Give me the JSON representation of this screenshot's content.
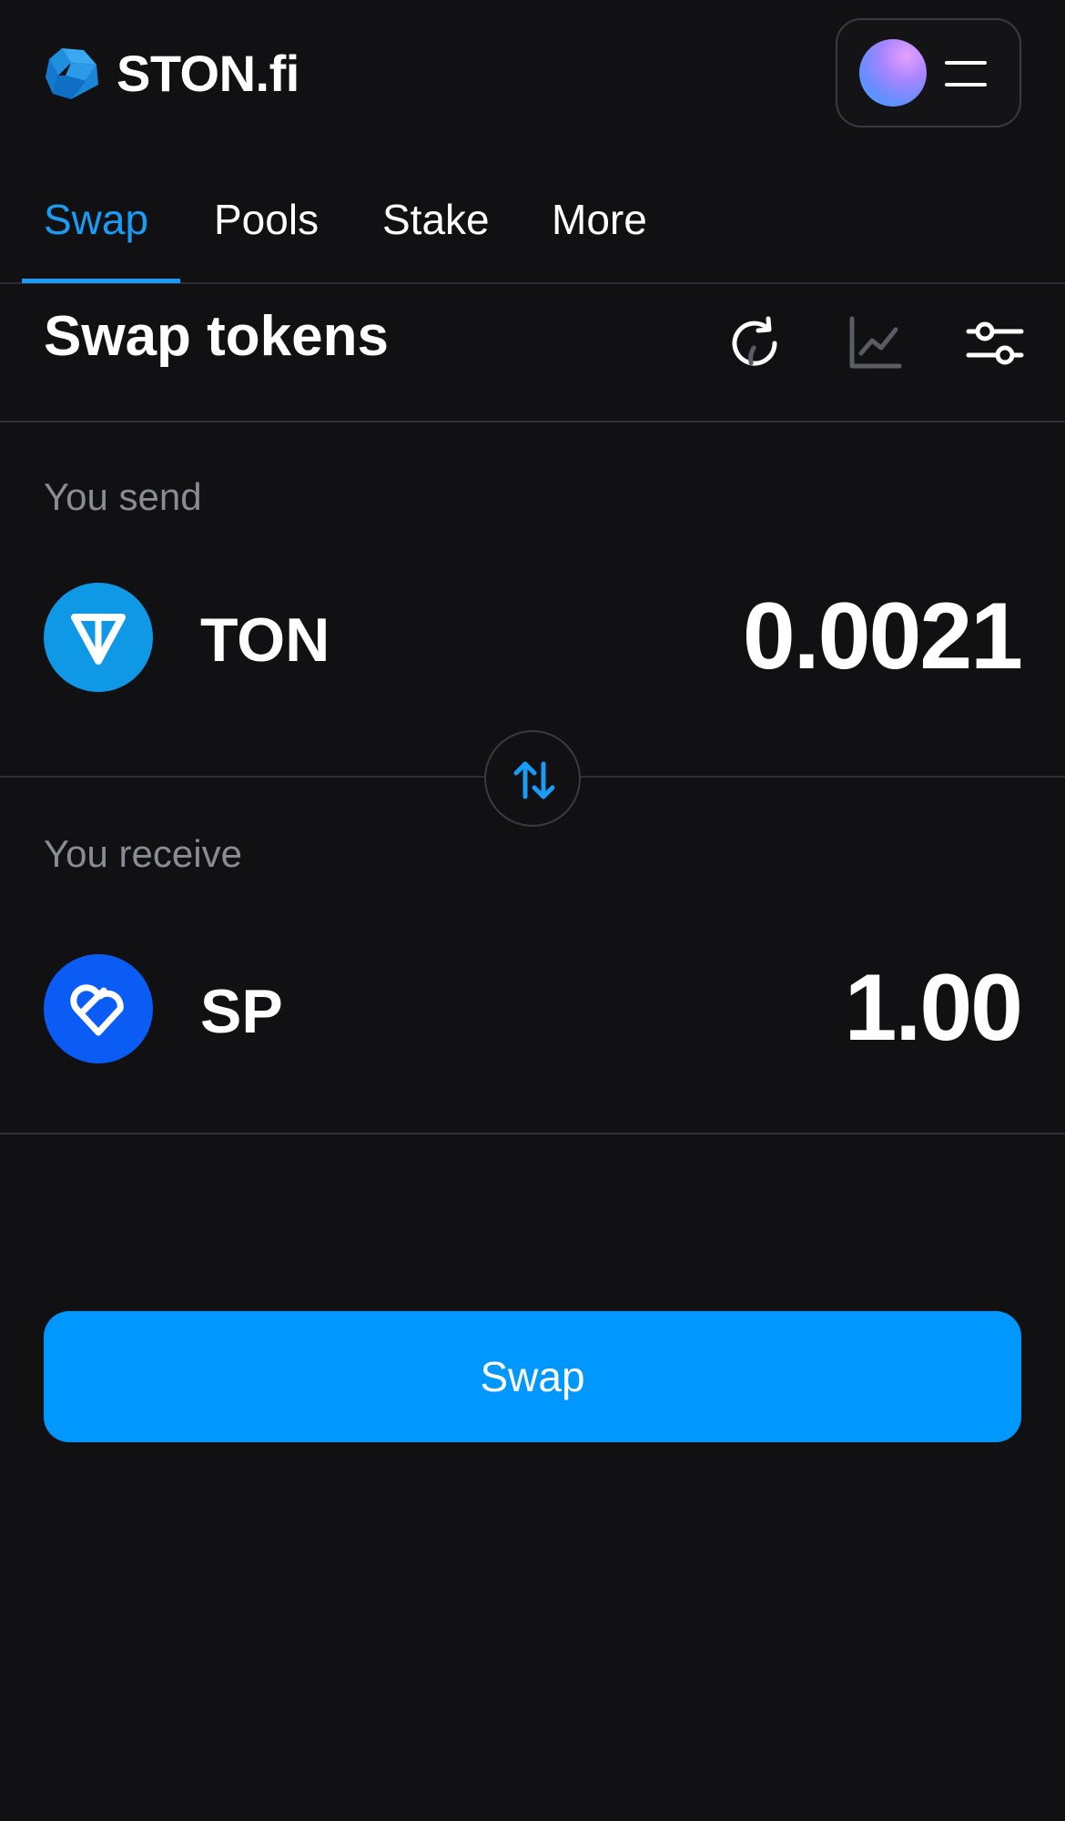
{
  "header": {
    "logo_text": "STON.fi",
    "logo_icon": "ston-fi-logo-icon",
    "avatar_icon": "avatar-gradient-icon",
    "menu_icon": "hamburger-menu-icon"
  },
  "tabs": [
    {
      "label": "Swap",
      "active": true
    },
    {
      "label": "Pools",
      "active": false
    },
    {
      "label": "Stake",
      "active": false
    },
    {
      "label": "More",
      "active": false
    }
  ],
  "swap_panel": {
    "title": "Swap tokens",
    "tools": [
      "refresh-icon",
      "chart-icon",
      "settings-sliders-icon"
    ],
    "send": {
      "label": "You send",
      "token_symbol": "TON",
      "token_icon": "ton-icon",
      "amount": "0.0021"
    },
    "receive": {
      "label": "You receive",
      "token_symbol": "SP",
      "token_icon": "sp-token-icon",
      "amount": "1.00"
    },
    "swap_direction_icon": "swap-arrows-icon",
    "submit_label": "Swap"
  },
  "colors": {
    "background": "#111114",
    "accent": "#1a9cf5",
    "button": "#0098ff",
    "muted_text": "#8a8c94",
    "divider": "#2e2f34",
    "ton_blue": "#0f98e6",
    "sp_blue": "#0a5cf5"
  }
}
